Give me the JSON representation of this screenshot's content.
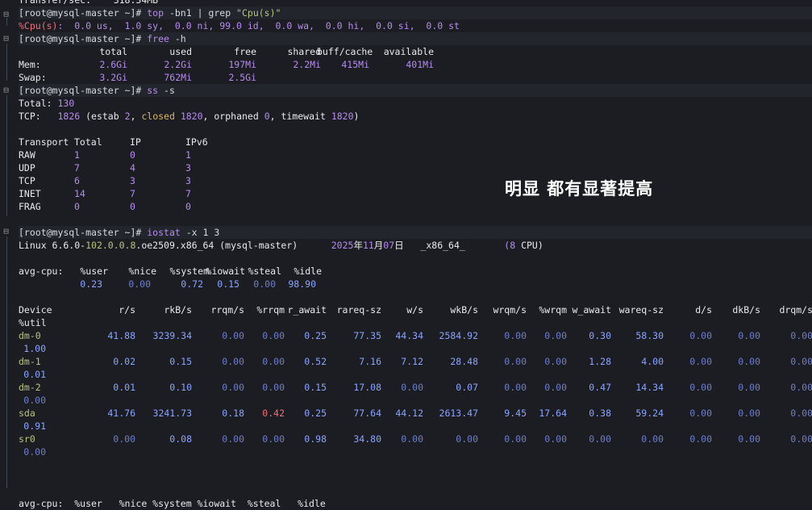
{
  "top_cut": "Transfer/sec:    318.34MB",
  "prompt": "[root@mysql-master ~]#",
  "cmd1": {
    "name": "top",
    "args": " -bn1 | grep ",
    "str": "\"Cpu(s)\""
  },
  "cpu_line": {
    "label": "%Cpu(s)",
    "rest": ":  0.0 us,  1.0 sy,  0.0 ni, 99.0 id,  0.0 wa,  0.0 hi,  0.0 si,  0.0 st"
  },
  "cmd2": {
    "name": "free",
    "args": " -h"
  },
  "free": {
    "headers": [
      "total",
      "used",
      "free",
      "shared",
      "buff/cache",
      "available"
    ],
    "rows": [
      {
        "label": "Mem:",
        "vals": [
          "2.6Gi",
          "2.2Gi",
          "197Mi",
          "2.2Mi",
          "415Mi",
          "401Mi"
        ]
      },
      {
        "label": "Swap:",
        "vals": [
          "3.2Gi",
          "762Mi",
          "2.5Gi",
          "",
          "",
          ""
        ]
      }
    ]
  },
  "cmd3": {
    "name": "ss",
    "args": " -s"
  },
  "ss": {
    "total_label": "Total:",
    "total_val": "130",
    "tcp_label": "TCP:",
    "tcp_val": "1826",
    "tcp_detail": [
      {
        "t": " (estab ",
        "cls": "wht"
      },
      {
        "t": "2",
        "cls": "num"
      },
      {
        "t": ", ",
        "cls": "wht"
      },
      {
        "t": "closed",
        "cls": "ylw"
      },
      {
        "t": " 1820",
        "cls": "num"
      },
      {
        "t": ", orphaned ",
        "cls": "wht"
      },
      {
        "t": "0",
        "cls": "num"
      },
      {
        "t": ", timewait ",
        "cls": "wht"
      },
      {
        "t": "1820",
        "cls": "num"
      },
      {
        "t": ")",
        "cls": "wht"
      }
    ],
    "headers": [
      "Transport",
      "Total",
      "IP",
      "IPv6"
    ],
    "rows": [
      [
        "RAW",
        "1",
        "0",
        "1"
      ],
      [
        "UDP",
        "7",
        "4",
        "3"
      ],
      [
        "TCP",
        "6",
        "3",
        "3"
      ],
      [
        "INET",
        "14",
        "7",
        "7"
      ],
      [
        "FRAG",
        "0",
        "0",
        "0"
      ]
    ]
  },
  "annotation": "明显 都有显著提高",
  "cmd4": {
    "name": "iostat",
    "args": " -x 1 3"
  },
  "sysline": [
    {
      "t": "Linux 6.6.0-",
      "cls": "wht"
    },
    {
      "t": "102.0.0.8",
      "cls": "grn"
    },
    {
      "t": ".oe2509.x86_64 (mysql-master)      ",
      "cls": "wht"
    },
    {
      "t": "2025",
      "cls": "num"
    },
    {
      "t": "年",
      "cls": "wht"
    },
    {
      "t": "11",
      "cls": "num"
    },
    {
      "t": "月",
      "cls": "wht"
    },
    {
      "t": "07",
      "cls": "num"
    },
    {
      "t": "日   _x86_64_       ",
      "cls": "wht"
    },
    {
      "t": "(8",
      "cls": "num"
    },
    {
      "t": " CPU)",
      "cls": "wht"
    }
  ],
  "avgcpu": {
    "label": "avg-cpu:",
    "headers": [
      "%user",
      "%nice",
      "%system",
      "%iowait",
      "%steal",
      "%idle"
    ],
    "vals": [
      "0.23",
      "0.00",
      "0.72",
      "0.15",
      "0.00",
      "98.90"
    ]
  },
  "dev": {
    "headers": [
      "Device",
      "r/s",
      "rkB/s",
      "rrqm/s",
      "%rrqm",
      "r_await",
      "rareq-sz",
      "w/s",
      "wkB/s",
      "wrqm/s",
      "%wrqm",
      "w_await",
      "wareq-sz",
      "d/s",
      "dkB/s",
      "drqm/s"
    ],
    "util_header": "%util",
    "rows": [
      {
        "name": "dm-0",
        "vals": [
          "41.88",
          "3239.34",
          "0.00",
          "0.00",
          "0.25",
          "77.35",
          "44.34",
          "2584.92",
          "0.00",
          "0.00",
          "0.30",
          "58.30",
          "0.00",
          "0.00",
          "0.00"
        ],
        "util": "1.00"
      },
      {
        "name": "dm-1",
        "vals": [
          "0.02",
          "0.15",
          "0.00",
          "0.00",
          "0.52",
          "7.16",
          "7.12",
          "28.48",
          "0.00",
          "0.00",
          "1.28",
          "4.00",
          "0.00",
          "0.00",
          "0.00"
        ],
        "util": "0.01"
      },
      {
        "name": "dm-2",
        "vals": [
          "0.01",
          "0.10",
          "0.00",
          "0.00",
          "0.15",
          "17.08",
          "0.00",
          "0.07",
          "0.00",
          "0.00",
          "0.47",
          "14.34",
          "0.00",
          "0.00",
          "0.00"
        ],
        "util": "0.00"
      },
      {
        "name": "sda",
        "vals": [
          "41.76",
          "3241.73",
          "0.18",
          "0.42",
          "0.25",
          "77.64",
          "44.12",
          "2613.47",
          "9.45",
          "17.64",
          "0.38",
          "59.24",
          "0.00",
          "0.00",
          "0.00"
        ],
        "util": "0.91"
      },
      {
        "name": "sr0",
        "vals": [
          "0.00",
          "0.08",
          "0.00",
          "0.00",
          "0.98",
          "34.80",
          "0.00",
          "0.00",
          "0.00",
          "0.00",
          "0.00",
          "0.00",
          "0.00",
          "0.00",
          "0.00"
        ],
        "util": "0.00"
      }
    ]
  },
  "bottom_cut": "avg-cpu:  %user   %nice %system %iowait  %steal   %idle"
}
